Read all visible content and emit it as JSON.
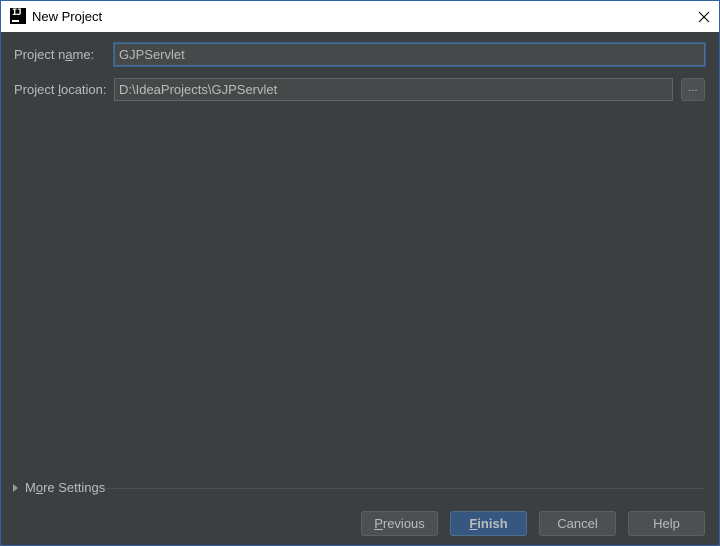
{
  "window": {
    "title": "New Project",
    "app_icon": "intellij-idea-icon",
    "app_icon_glyph": "IJ"
  },
  "form": {
    "project_name_label_pre": "Project n",
    "project_name_label_mnemonic": "a",
    "project_name_label_post": "me:",
    "project_name_value": "GJPServlet",
    "project_location_label_pre": "Project ",
    "project_location_label_mnemonic": "l",
    "project_location_label_post": "ocation:",
    "project_location_value": "D:\\IdeaProjects\\GJPServlet",
    "browse_label": "..."
  },
  "more_settings": {
    "label_pre": "M",
    "label_mnemonic": "o",
    "label_post": "re Settings",
    "expanded": false
  },
  "buttons": {
    "previous_mnemonic": "P",
    "previous_rest": "revious",
    "finish_mnemonic": "F",
    "finish_rest": "inish",
    "cancel_label": "Cancel",
    "help_label": "Help"
  },
  "colors": {
    "background": "#3c3f41",
    "accent": "#365880",
    "text": "#bbbbbb",
    "focus_border": "#466d94"
  }
}
